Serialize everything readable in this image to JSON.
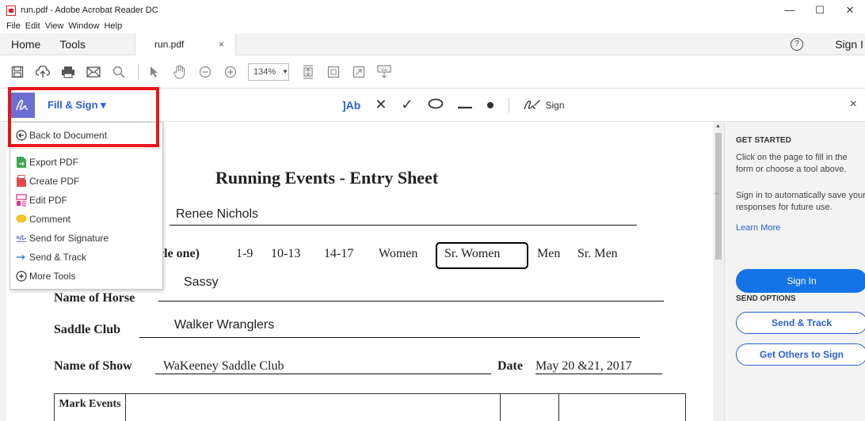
{
  "window": {
    "title": "run.pdf - Adobe Acrobat Reader DC",
    "minimize": "—",
    "maximize": "☐",
    "close": "✕"
  },
  "menu": [
    "File",
    "Edit",
    "View",
    "Window",
    "Help"
  ],
  "tabs": {
    "home": "Home",
    "tools": "Tools",
    "document": "run.pdf",
    "document_close": "×",
    "help": "?",
    "sign_in": "Sign I"
  },
  "toolbar": {
    "zoom_level": "134%"
  },
  "fill_sign": {
    "label": "Fill & Sign ▾",
    "text_tool": "]Ab",
    "cross_tool": "✕",
    "check_tool": "✓",
    "sign_label": "Sign",
    "close": "×"
  },
  "dropdown": {
    "items": [
      {
        "label": "Back to Document",
        "icon": "back-arrow-icon"
      },
      {
        "label": "Export PDF",
        "icon": "export-pdf-icon"
      },
      {
        "label": "Create PDF",
        "icon": "create-pdf-icon"
      },
      {
        "label": "Edit PDF",
        "icon": "edit-pdf-icon"
      },
      {
        "label": "Comment",
        "icon": "comment-icon"
      },
      {
        "label": "Send for Signature",
        "icon": "send-signature-icon"
      },
      {
        "label": "Send & Track",
        "icon": "send-track-icon"
      },
      {
        "label": "More Tools",
        "icon": "plus-circle-icon"
      }
    ]
  },
  "document": {
    "title": "Running Events - Entry Sheet",
    "rider_name": "Renee Nichols",
    "age_label": "cle one)",
    "age_options": [
      "1-9",
      "10-13",
      "14-17",
      "Women",
      "Sr. Women",
      "Men",
      "Sr. Men"
    ],
    "selected_age": "Sr. Women",
    "horse_label": "Name of Horse",
    "horse_name": "Sassy",
    "club_label": "Saddle Club",
    "club_name": "Walker Wranglers",
    "show_label": "Name of Show",
    "show_name": "WaKeeney Saddle Club",
    "date_label": "Date",
    "date_value": "May 20 &21, 2017",
    "table_header": "Mark Events"
  },
  "right_pane": {
    "get_started_heading": "GET STARTED",
    "get_started_text": "Click on the page to fill in the form or choose a tool above.",
    "sign_in_text": "Sign in to automatically save your responses for future use.",
    "learn_more": "Learn More",
    "sign_in_button": "Sign In",
    "send_options_heading": "SEND OPTIONS",
    "send_track_button": "Send & Track",
    "get_others_button": "Get Others to Sign"
  },
  "colors": {
    "accent": "#2b61d3",
    "primary_button": "#1473e6",
    "highlight": "#e8141b",
    "fill_sign_icon": "#6d6ed3"
  }
}
